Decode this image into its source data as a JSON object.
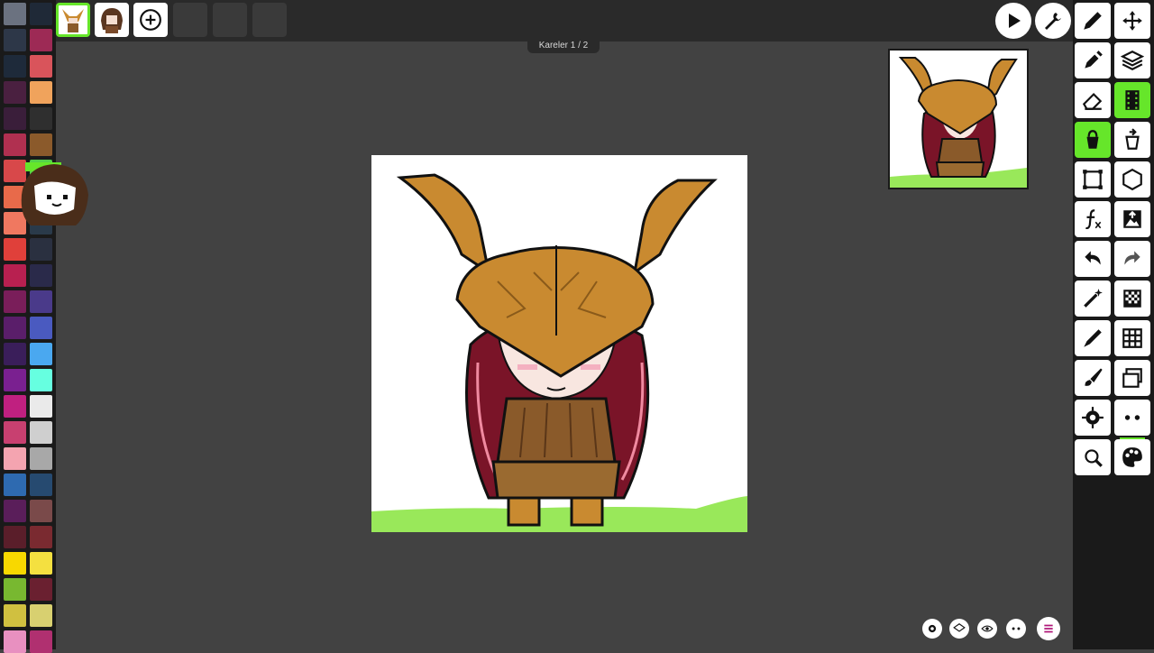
{
  "frame_label": "Kareler 1 / 2",
  "palette": {
    "colors": [
      "#6b7280",
      "#1f2937",
      "#2d3748",
      "#9d2a55",
      "#1e2a3a",
      "#d9545b",
      "#4a2040",
      "#f0a35c",
      "#3a1e3a",
      "#2f2f2f",
      "#b03050",
      "#8b5a2b",
      "#d8484a",
      "#54d24a",
      "#e86a4a",
      "#2e4a5a",
      "#f07860",
      "#2a3a4a",
      "#e0403a",
      "#2a3040",
      "#b82050",
      "#2a2a4a",
      "#7a1e5a",
      "#4a3a8a",
      "#5a1e6a",
      "#4a5ac0",
      "#3a1e5a",
      "#4aa8f0",
      "#7a2090",
      "#66ffe0",
      "#c02080",
      "#eaeaea",
      "#c84070",
      "#cfcfcf",
      "#f4a4b0",
      "#a8a8a8",
      "#2e6ab0",
      "#264a70",
      "#5a1e5a",
      "#7a4a4a",
      "#5a1e2a",
      "#7a2a30",
      "#f8d800",
      "#f4e040",
      "#78b830",
      "#6a2030",
      "#d0c040",
      "#d8d070",
      "#e890c0",
      "#b03070"
    ]
  },
  "frames": [
    {
      "name": "frame-1"
    },
    {
      "name": "frame-2"
    }
  ],
  "tools": {
    "play": "play-icon",
    "settings": "wrench-icon",
    "pencil": "pencil-icon",
    "move": "move-icon",
    "eyedropper": "eyedropper-icon",
    "layers": "layers-icon",
    "eraser": "eraser-icon",
    "film": "film-icon",
    "bucket": "bucket-icon",
    "swap": "swap-icon",
    "select": "select-icon",
    "polygon": "hexagon-icon",
    "effects": "fx-icon",
    "image": "image-icon",
    "undo": "undo-icon",
    "redo": "redo-icon",
    "magic": "magic-wand-icon",
    "grid_small": "checker-icon",
    "pen": "pen-icon",
    "grid": "grid-icon",
    "brush": "brush-icon",
    "windows": "windows-icon",
    "gear": "gear-icon",
    "more": "more-icon",
    "zoom": "zoom-icon",
    "palette": "palette-icon"
  },
  "colors": {
    "accent": "#66e62a",
    "panel": "#1a1a1a",
    "background": "#424242"
  }
}
